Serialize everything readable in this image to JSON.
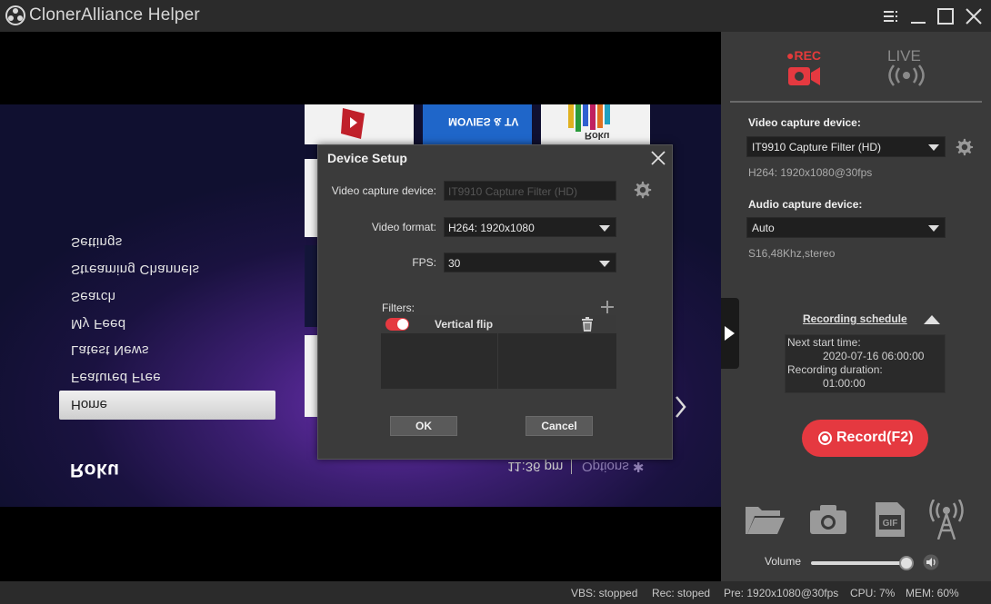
{
  "window": {
    "title": "ClonerAlliance Helper",
    "icons": {
      "logo": "app-logo-icon",
      "menu": "menu-icon",
      "minimize": "minimize-icon",
      "maximize": "maximize-icon",
      "close": "close-icon"
    }
  },
  "preview": {
    "menu_items": [
      "Settings",
      "Streaming Channels",
      "Search",
      "My Feed",
      "Latest News",
      "Featured Free"
    ],
    "selected_item": "Home",
    "brand": "Roku",
    "time": "11:36 pm",
    "options": "Options ✱",
    "tile_texts": [
      "MOVIES & TV",
      "Roku"
    ]
  },
  "panel": {
    "tabs": {
      "rec_label": "●REC",
      "live_label": "LIVE"
    },
    "video_device_label": "Video capture device:",
    "video_device_value": "IT9910 Capture Filter (HD)",
    "video_info": "H264: 1920x1080@30fps",
    "audio_device_label": "Audio capture device:",
    "audio_device_value": "Auto",
    "audio_info": "S16,48Khz,stereo",
    "schedule": {
      "link": "Recording schedule",
      "next_start_label": "Next start time:",
      "next_start_value": "2020-07-16 06:00:00",
      "duration_label": "Recording duration:",
      "duration_value": "01:00:00"
    },
    "record_button": "Record(F2)",
    "tools": [
      "folder-icon",
      "camera-icon",
      "gif-icon",
      "broadcast-icon"
    ],
    "volume_label": "Volume",
    "volume_level": 0.95
  },
  "status": {
    "vbs": "VBS: stopped",
    "rec": "Rec: stoped",
    "pre": "Pre: 1920x1080@30fps",
    "cpu": "CPU: 7%",
    "mem": "MEM: 60%"
  },
  "dialog": {
    "title": "Device Setup",
    "video_device_label": "Video capture device:",
    "video_device_value": "IT9910 Capture Filter (HD)",
    "video_format_label": "Video format:",
    "video_format_value": "H264: 1920x1080",
    "fps_label": "FPS:",
    "fps_value": "30",
    "filters_label": "Filters:",
    "filters": [
      {
        "name": "Vertical flip",
        "enabled": true
      }
    ],
    "ok_label": "OK",
    "cancel_label": "Cancel"
  },
  "colors": {
    "accent": "#e53940",
    "panel_bg": "#3a3a3a",
    "dialog_bg": "#3b3b3b"
  }
}
